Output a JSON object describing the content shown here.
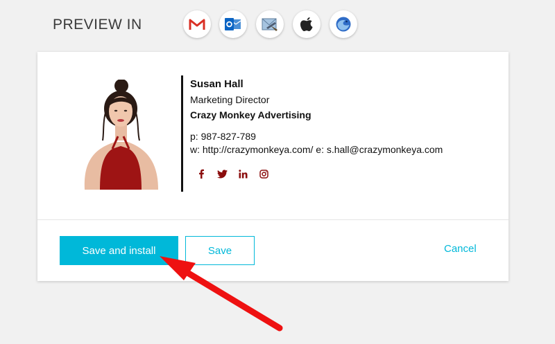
{
  "preview": {
    "title": "PREVIEW IN",
    "clients": [
      "gmail-icon",
      "outlook-icon",
      "apple-mail-icon",
      "apple-icon",
      "thunderbird-icon"
    ]
  },
  "signature": {
    "name": "Susan Hall",
    "title": "Marketing Director",
    "company": "Crazy Monkey Advertising",
    "phone": "p: 987-827-789",
    "web_email": "w: http://crazymonkeya.com/  e: s.hall@crazymonkeya.com",
    "social": [
      "facebook-icon",
      "twitter-icon",
      "linkedin-icon",
      "instagram-icon"
    ],
    "accent_color": "#8b0d0d"
  },
  "actions": {
    "save_install": "Save and install",
    "save": "Save",
    "cancel": "Cancel"
  },
  "colors": {
    "primary": "#00b8d9",
    "annotation": "#ee1111"
  }
}
